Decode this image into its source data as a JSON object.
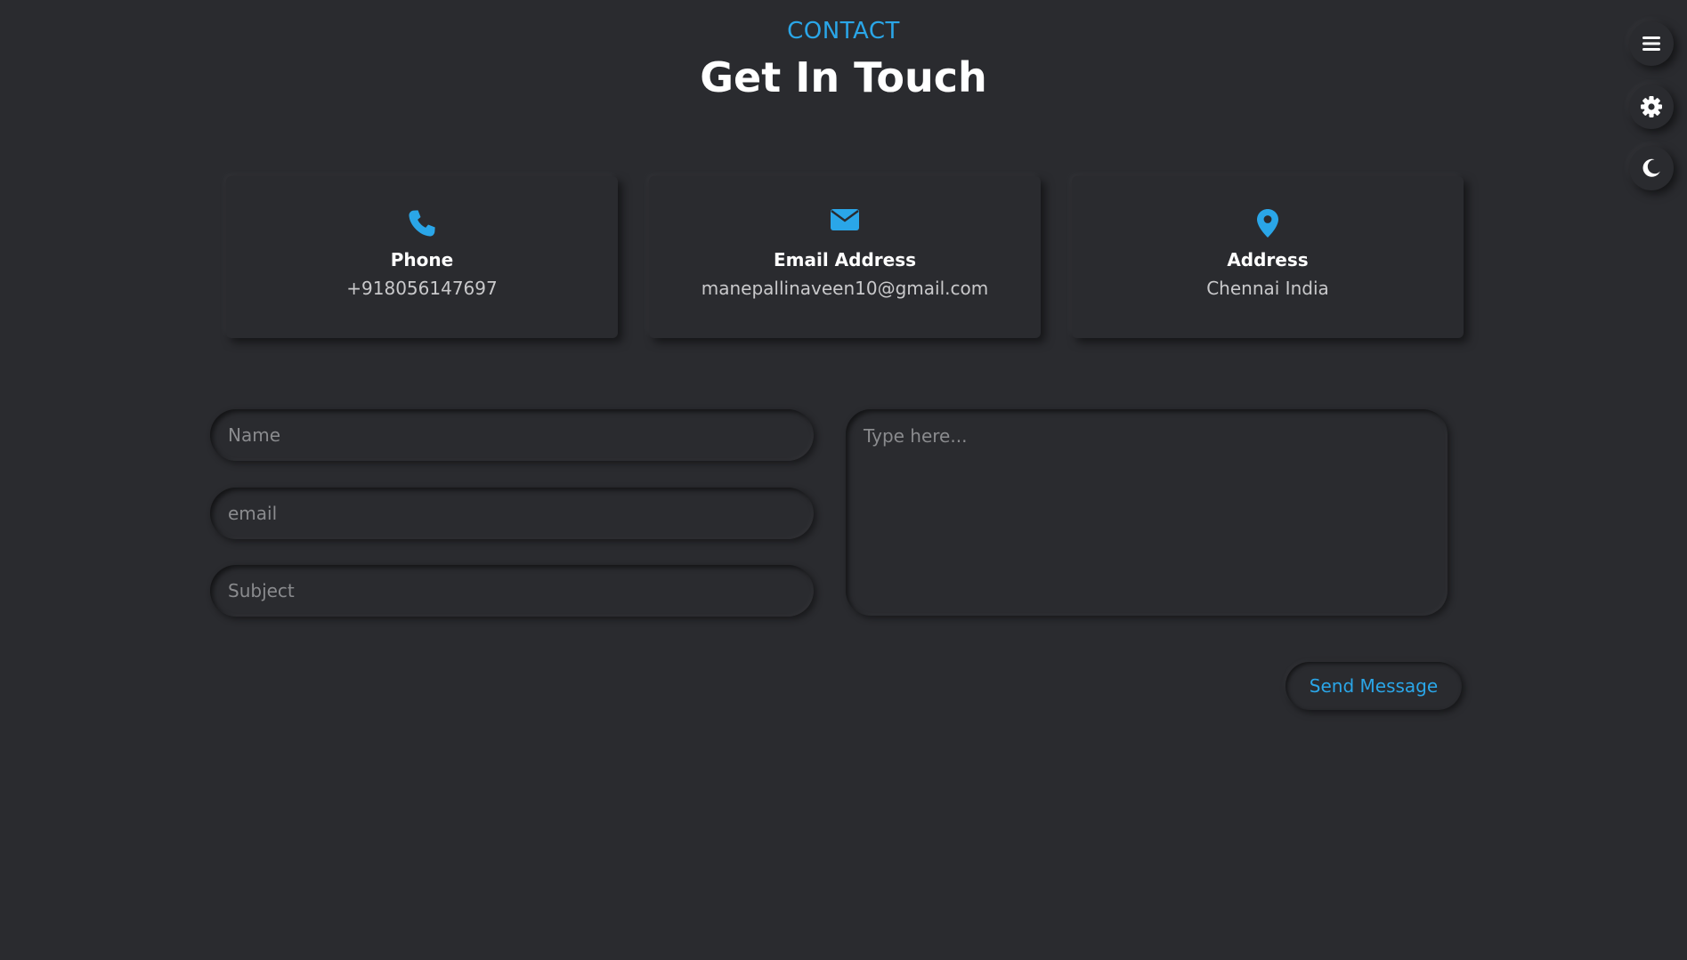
{
  "header": {
    "kicker": "CONTACT",
    "title": "Get In Touch"
  },
  "rail": [
    {
      "name": "menu",
      "icon": "hamburger-menu-icon"
    },
    {
      "name": "settings",
      "icon": "gear-icon"
    },
    {
      "name": "theme",
      "icon": "moon-icon"
    }
  ],
  "cards": [
    {
      "icon": "phone-icon",
      "label": "Phone",
      "value": "+918056147697"
    },
    {
      "icon": "envelope-icon",
      "label": "Email Address",
      "value": "manepallinaveen10@gmail.com"
    },
    {
      "icon": "map-pin-icon",
      "label": "Address",
      "value": "Chennai India"
    }
  ],
  "form": {
    "name_placeholder": "Name",
    "email_placeholder": "email",
    "subject_placeholder": "Subject",
    "message_placeholder": "Type here...",
    "send_label": "Send Message"
  },
  "colors": {
    "background": "#2a2b2f",
    "accent": "#2aa6e8",
    "title": "#ffffff"
  }
}
